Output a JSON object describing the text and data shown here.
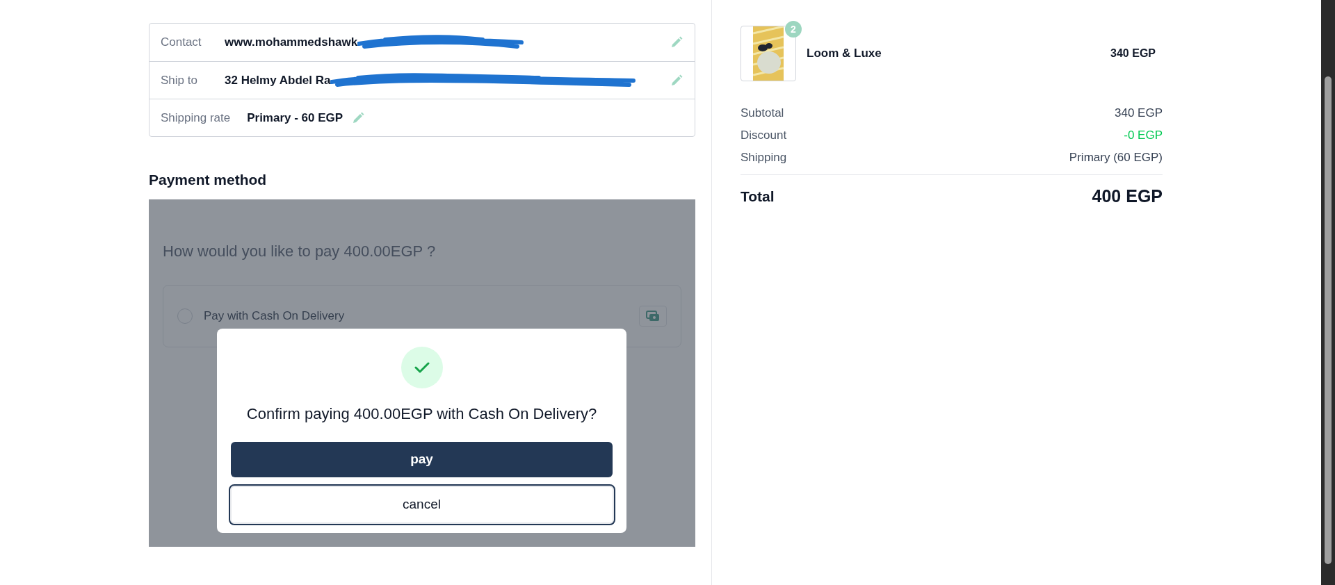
{
  "details": [
    {
      "label": "Contact",
      "value": "www.mohammedshawk",
      "redacted": true,
      "editable": true
    },
    {
      "label": "Ship to",
      "value": "32 Helmy Abdel Ra",
      "redacted": true,
      "editable": true
    },
    {
      "label": "Shipping rate",
      "value": "Primary - 60 EGP",
      "redacted": false,
      "editable": true
    }
  ],
  "payment": {
    "heading": "Payment method",
    "question": "How would you like to pay 400.00EGP ?",
    "options": [
      {
        "label": "Pay with Cash On Delivery",
        "selected": false
      }
    ]
  },
  "dialog": {
    "message": "Confirm paying 400.00EGP with Cash On Delivery?",
    "buttons": [
      {
        "label": "pay",
        "kind": "primary"
      },
      {
        "label": "cancel",
        "kind": "secondary"
      }
    ]
  },
  "cart": {
    "items": [
      {
        "name": "Loom & Luxe",
        "quantity": "2",
        "price": "340 EGP"
      }
    ],
    "summary": [
      {
        "label": "Subtotal",
        "value": "340 EGP",
        "kind": "normal"
      },
      {
        "label": "Discount",
        "value": "-0 EGP",
        "kind": "discount"
      },
      {
        "label": "Shipping",
        "value": "Primary (60 EGP)",
        "kind": "normal"
      }
    ],
    "total": {
      "label": "Total",
      "value": "400 EGP"
    }
  }
}
